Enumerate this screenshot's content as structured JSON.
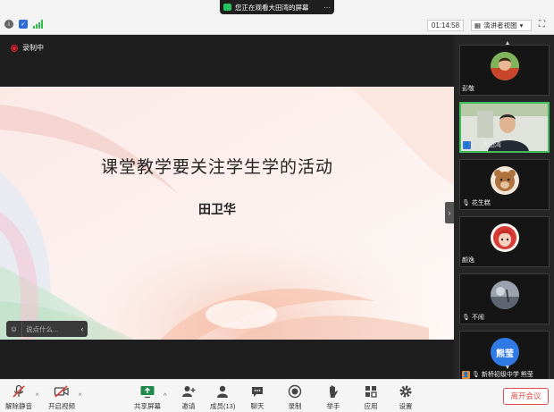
{
  "banner": {
    "text": "您正在观看大田湾的屏幕"
  },
  "header": {
    "timer": "01:14:58",
    "view_mode": "演讲者视图"
  },
  "recording": {
    "label": "录制中"
  },
  "slide": {
    "title": "课堂教学要关注学生学的活动",
    "author": "田卫华"
  },
  "chat": {
    "placeholder": "说点什么..."
  },
  "participants": [
    {
      "name": "彭敬",
      "avatar": "photo",
      "active": false
    },
    {
      "name": "大田湾",
      "avatar": "photo",
      "active": true,
      "host": true
    },
    {
      "name": "花生糕",
      "avatar": "photo",
      "active": false
    },
    {
      "name": "颜逸",
      "avatar": "photo",
      "active": false
    },
    {
      "name": "不闹",
      "avatar": "photo",
      "active": false
    },
    {
      "name": "新桥初级中学 熊莹",
      "avatar": "text",
      "avatar_text": "熊莹",
      "active": false,
      "host": true
    }
  ],
  "toolbar": {
    "unmute": "解除静音",
    "start_video": "开启视频",
    "share_screen": "共享屏幕",
    "invite": "邀请",
    "members": "成员(13)",
    "chat": "聊天",
    "record": "录制",
    "raise_hand": "举手",
    "apps": "应用",
    "settings": "设置",
    "leave": "离开会议"
  },
  "colors": {
    "accent_green": "#3fbf5a",
    "leave_red": "#e04b4b",
    "host_blue": "#3a78d8"
  }
}
